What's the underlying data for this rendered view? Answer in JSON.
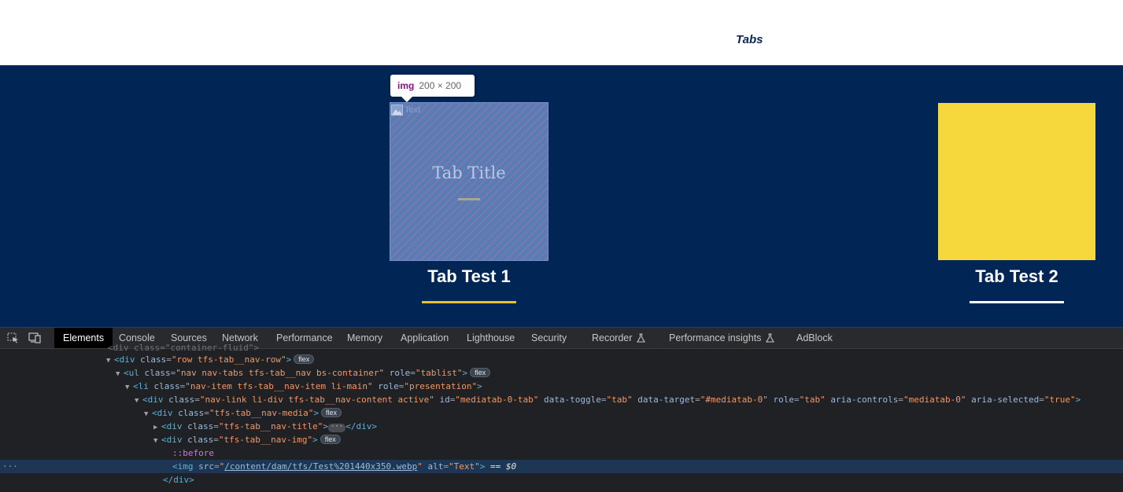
{
  "page": {
    "heading": "Tabs",
    "tabs": [
      {
        "label": "Tab Test 1",
        "image_title": "Tab Title",
        "image_alt": "Text",
        "underline_color": "#e9c12a",
        "image_color": "#5a7db0"
      },
      {
        "label": "Tab Test 2",
        "underline_color": "#ffffff",
        "image_color": "#f6d83c"
      }
    ]
  },
  "tooltip": {
    "tag": "img",
    "dims": "200 × 200"
  },
  "devtools": {
    "tabs": [
      {
        "label": "Elements",
        "active": true
      },
      {
        "label": "Console"
      },
      {
        "label": "Sources"
      },
      {
        "label": "Network"
      },
      {
        "label": "Performance"
      },
      {
        "label": "Memory"
      },
      {
        "label": "Application"
      },
      {
        "label": "Lighthouse"
      },
      {
        "label": "Security"
      },
      {
        "label": "Recorder",
        "flask": true
      },
      {
        "label": "Performance insights",
        "flask": true
      },
      {
        "label": "AdBlock"
      }
    ],
    "dom": {
      "partial_line": "div class=\"container-fluid\"",
      "l1": {
        "tag": "div",
        "class": "row tfs-tab__nav-row",
        "badge": "flex"
      },
      "l2": {
        "tag": "ul",
        "class": "nav nav-tabs tfs-tab__nav bs-container",
        "role": "tablist",
        "badge": "flex"
      },
      "l3": {
        "tag": "li",
        "class": "nav-item tfs-tab__nav-item li-main",
        "role": "presentation"
      },
      "l4": {
        "tag": "div",
        "class": "nav-link li-div tfs-tab__nav-content active",
        "id": "mediatab-0-tab",
        "data_toggle": "tab",
        "data_target": "#mediatab-0",
        "role": "tab",
        "aria_controls": "mediatab-0",
        "aria_selected": "true"
      },
      "l5": {
        "tag": "div",
        "class": "tfs-tab__nav-media",
        "badge": "flex"
      },
      "l6": {
        "tag": "div",
        "class": "tfs-tab__nav-title",
        "ellipsis": "···",
        "close": "</div>"
      },
      "l7": {
        "tag": "div",
        "class": "tfs-tab__nav-img",
        "badge": "flex"
      },
      "l8": {
        "pseudo": "::before"
      },
      "l9": {
        "tag": "img",
        "src": "/content/dam/tfs/Test%201440x350.webp",
        "alt": "Text",
        "eq": "== $0"
      },
      "l10": {
        "close": "</div>"
      }
    }
  }
}
